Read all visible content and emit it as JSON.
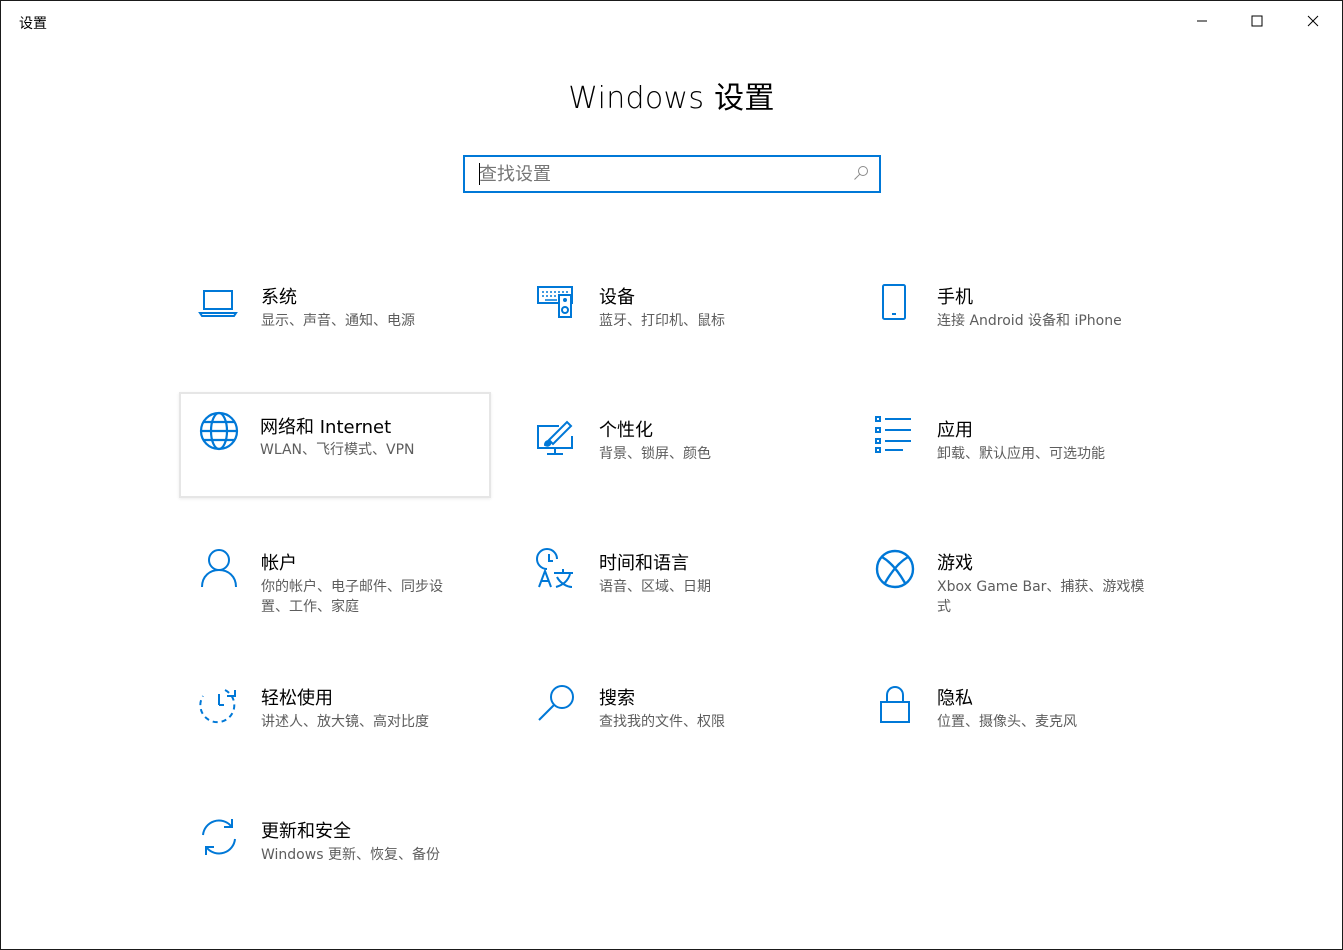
{
  "window": {
    "title": "设置"
  },
  "header": {
    "title": "Windows 设置"
  },
  "search": {
    "placeholder": "查找设置",
    "value": ""
  },
  "colors": {
    "accent": "#0078d7",
    "icon": "#0078d7",
    "description": "#5d5d5d"
  },
  "categories": [
    {
      "name": "系统",
      "desc": "显示、声音、通知、电源",
      "icon": "laptop-icon"
    },
    {
      "name": "设备",
      "desc": "蓝牙、打印机、鼠标",
      "icon": "devices-icon"
    },
    {
      "name": "手机",
      "desc": "连接 Android 设备和 iPhone",
      "icon": "phone-icon"
    },
    {
      "name": "网络和 Internet",
      "desc": "WLAN、飞行模式、VPN",
      "icon": "globe-icon"
    },
    {
      "name": "个性化",
      "desc": "背景、锁屏、颜色",
      "icon": "personalization-icon"
    },
    {
      "name": "应用",
      "desc": "卸载、默认应用、可选功能",
      "icon": "apps-list-icon"
    },
    {
      "name": "帐户",
      "desc": "你的帐户、电子邮件、同步设置、工作、家庭",
      "icon": "person-icon"
    },
    {
      "name": "时间和语言",
      "desc": "语音、区域、日期",
      "icon": "time-language-icon"
    },
    {
      "name": "游戏",
      "desc": "Xbox Game Bar、捕获、游戏模式",
      "icon": "xbox-icon"
    },
    {
      "name": "轻松使用",
      "desc": "讲述人、放大镜、高对比度",
      "icon": "ease-of-access-icon"
    },
    {
      "name": "搜索",
      "desc": "查找我的文件、权限",
      "icon": "search-icon"
    },
    {
      "name": "隐私",
      "desc": "位置、摄像头、麦克风",
      "icon": "lock-icon"
    },
    {
      "name": "更新和安全",
      "desc": "Windows 更新、恢复、备份",
      "icon": "update-icon"
    }
  ]
}
